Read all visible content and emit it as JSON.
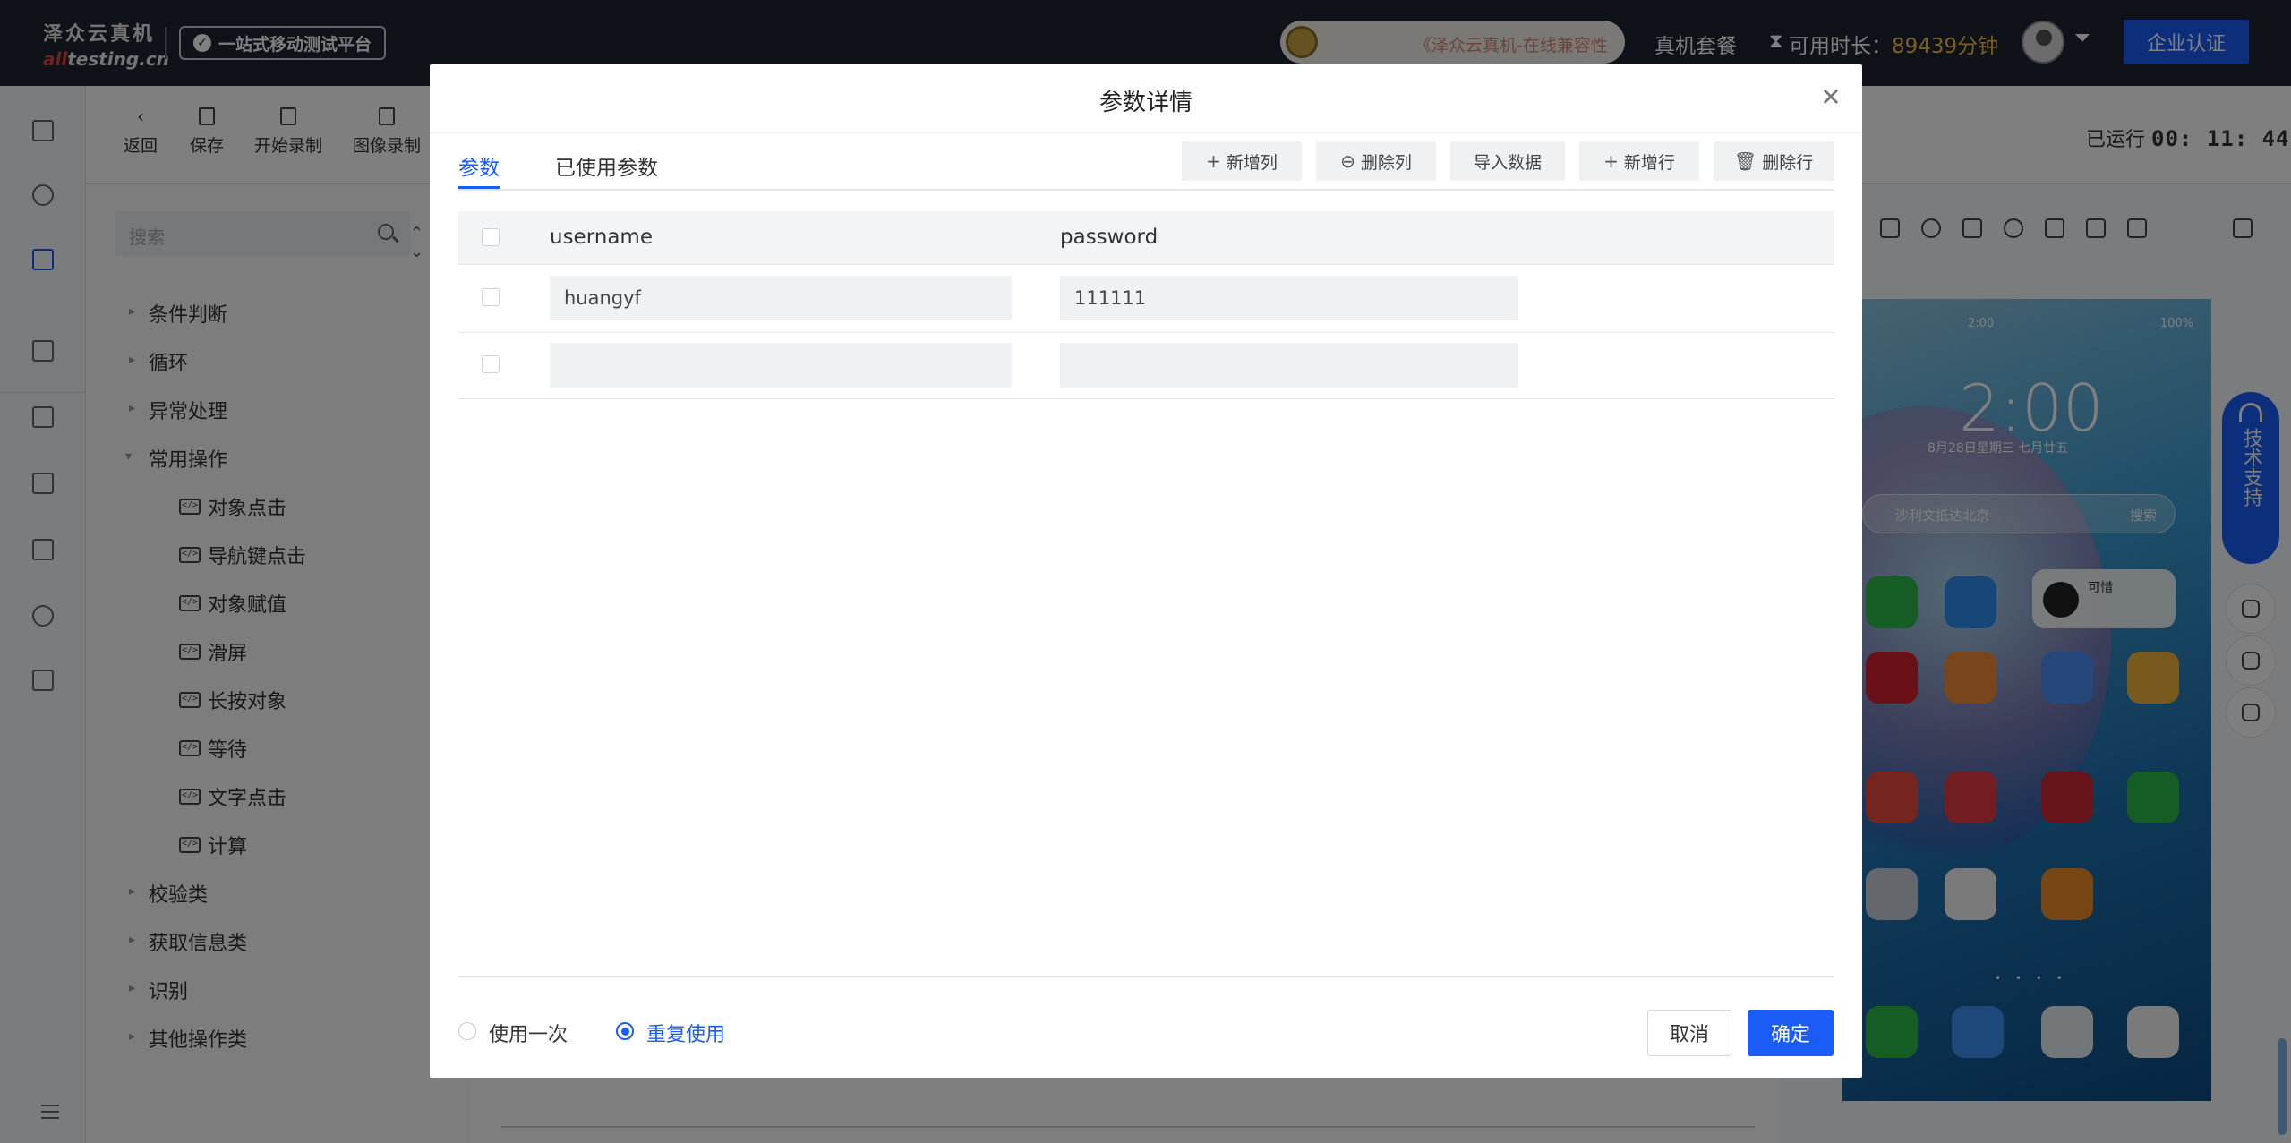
{
  "header": {
    "logo_cn": "泽众云真机",
    "logo_en_prefix": "all",
    "logo_en_suffix": "testing.cn",
    "platform_badge": "一站式移动测试平台",
    "marquee_text": "《泽众云真机-在线兼容性",
    "package_link": "真机套餐",
    "time_label": "可用时长：",
    "time_value": "89439分钟",
    "enterprise_button": "企业认证"
  },
  "toolbar": {
    "back": "返回",
    "save": "保存",
    "start_record": "开始录制",
    "image_record": "图像录制",
    "runtime_label": "已运行",
    "runtime_value": "00: 11: 44"
  },
  "tree": {
    "search_placeholder": "搜索",
    "groups": [
      {
        "label": "条件判断"
      },
      {
        "label": "循环"
      },
      {
        "label": "异常处理"
      },
      {
        "label": "常用操作"
      }
    ],
    "leaves": [
      "对象点击",
      "导航键点击",
      "对象赋值",
      "滑屏",
      "长按对象",
      "等待",
      "文字点击",
      "计算"
    ],
    "groups_after": [
      {
        "label": "校验类"
      },
      {
        "label": "获取信息类"
      },
      {
        "label": "识别"
      },
      {
        "label": "其他操作类"
      }
    ]
  },
  "phone": {
    "status_time": "2:00",
    "status_battery": "100%",
    "clock": "2:00",
    "date": "8月28日星期三 七月廿五",
    "search_text": "沙利文抵达北京",
    "search_button": "搜索",
    "music_title": "可惜"
  },
  "support": {
    "label": "技术支持"
  },
  "modal": {
    "title": "参数详情",
    "tabs": [
      "参数",
      "已使用参数"
    ],
    "buttons": {
      "add_column": "新增列",
      "delete_column": "删除列",
      "import_data": "导入数据",
      "add_row": "新增行",
      "delete_row": "删除行"
    },
    "columns": [
      "username",
      "password"
    ],
    "rows": [
      [
        "huangyf",
        "111111"
      ],
      [
        "",
        ""
      ]
    ],
    "radio_once": "使用一次",
    "radio_reuse": "重复使用",
    "cancel": "取消",
    "confirm": "确定"
  }
}
